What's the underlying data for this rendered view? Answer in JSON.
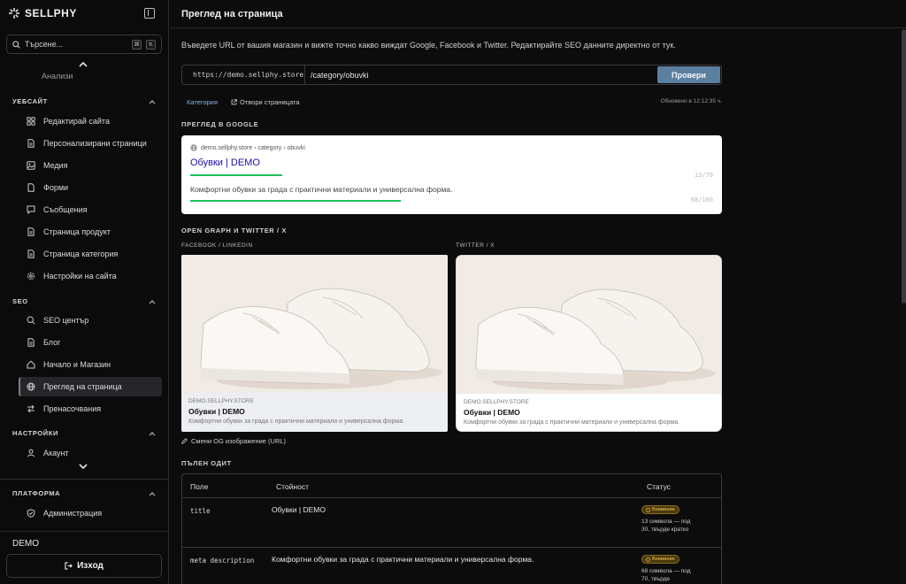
{
  "brand": {
    "name": "SELLPHY"
  },
  "search": {
    "placeholder": "Търсене...",
    "kbd_cmd": "⌘",
    "kbd_k": "K"
  },
  "sidebar": {
    "partial_item": "Анализи",
    "sections": [
      {
        "title": "УЕБСАЙТ",
        "items": [
          {
            "label": "Редактирай сайта",
            "icon": "grid-icon"
          },
          {
            "label": "Персонализирани страници",
            "icon": "page-icon"
          },
          {
            "label": "Медия",
            "icon": "image-icon"
          },
          {
            "label": "Форми",
            "icon": "form-icon"
          },
          {
            "label": "Съобщения",
            "icon": "message-icon"
          },
          {
            "label": "Страница продукт",
            "icon": "page-icon"
          },
          {
            "label": "Страница категория",
            "icon": "page-icon"
          },
          {
            "label": "Настройки на сайта",
            "icon": "gear-icon"
          }
        ]
      },
      {
        "title": "SEO",
        "items": [
          {
            "label": "SEO център",
            "icon": "search-icon"
          },
          {
            "label": "Блог",
            "icon": "page-icon"
          },
          {
            "label": "Начало и Магазин",
            "icon": "home-icon"
          },
          {
            "label": "Преглед на страница",
            "icon": "globe-icon",
            "active": true
          },
          {
            "label": "Пренасочвания",
            "icon": "redirect-icon"
          }
        ]
      },
      {
        "title": "НАСТРОЙКИ",
        "items": [
          {
            "label": "Акаунт",
            "icon": "user-icon"
          }
        ]
      },
      {
        "title": "ПЛАТФОРМА",
        "items": [
          {
            "label": "Администрация",
            "icon": "shield-icon"
          }
        ]
      }
    ],
    "workspace": "DEMO",
    "logout_label": "Изход"
  },
  "main": {
    "title": "Преглед на страница",
    "intro": "Въведете URL от вашия магазин и вижте точно какво виждат Google, Facebook и Twitter. Редактирайте SEO данните директно от тук.",
    "url_prefix": "https://demo.sellphy.store",
    "url_path": "/category/obuvki",
    "check_label": "Провери",
    "page_type_badge": "Категория",
    "open_page_label": "Отвори страницата",
    "updated_text": "Обновено в 12:12:35 ч."
  },
  "google_preview": {
    "section_title": "ПРЕГЛЕД В GOOGLE",
    "breadcrumb": "demo.sellphy.store › category › obuvki",
    "title": "Обувки | DEMO",
    "title_count": "13/70",
    "title_progress": 0.186,
    "description": "Комфортни обувки за града с практични материали и универсална форма.",
    "description_count": "68/160",
    "description_progress": 0.425,
    "bar_color": "#1fbf5b"
  },
  "social_preview": {
    "section_title": "OPEN GRAPH И TWITTER / X",
    "facebook": {
      "label": "FACEBOOK / LINKEDIN",
      "domain": "DEMO.SELLPHY.STORE",
      "title": "Обувки | DEMO",
      "description": "Комфортни обувки за града с практични материали и универсална форма."
    },
    "twitter": {
      "label": "TWITTER / X",
      "domain": "DEMO.SELLPHY.STORE",
      "title": "Обувки | DEMO",
      "description": "Комфортни обувки за града с практични материали и универсална форма."
    },
    "change_image_label": "Смени OG изображение (URL)"
  },
  "audit": {
    "section_title": "ПЪЛЕН ОДИТ",
    "columns": {
      "field": "Поле",
      "value": "Стойност",
      "status": "Статус"
    },
    "rows": [
      {
        "field": "title",
        "value": "Обувки | DEMO",
        "status": "Внимание",
        "note": "13 символа — под 30, твърде кратко"
      },
      {
        "field": "meta description",
        "value": "Комфортни обувки за града с практични материали и универсална форма.",
        "status": "Внимание",
        "note": "68 символа — под 70, твърде"
      }
    ],
    "warn_color": "#f0c552"
  }
}
